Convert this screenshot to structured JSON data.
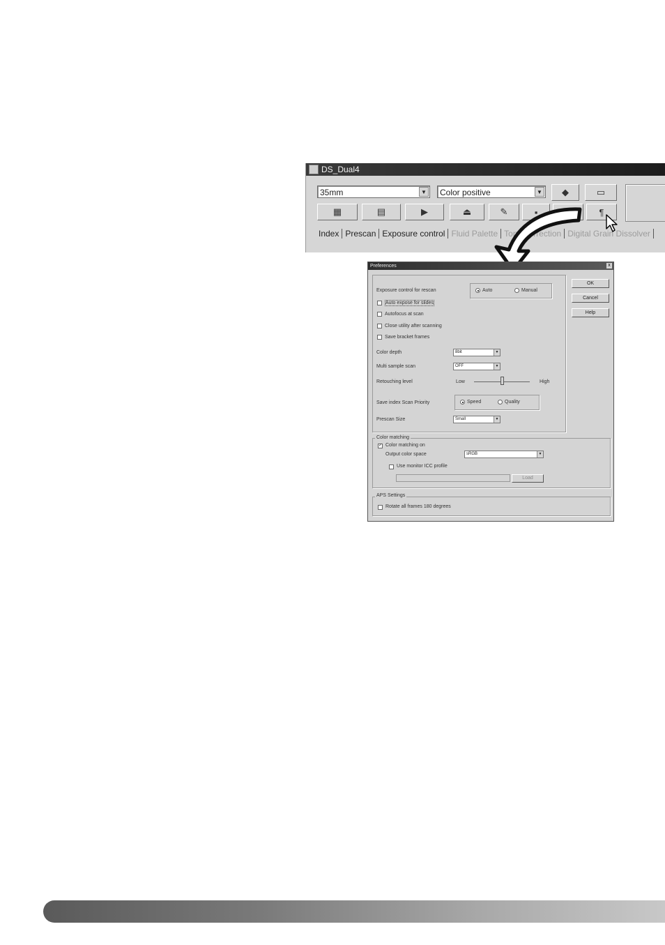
{
  "main_window": {
    "title": "DS_Dual4",
    "film_format": "35mm",
    "film_type": "Color positive",
    "tabs": [
      {
        "label": "Index",
        "enabled": true
      },
      {
        "label": "Prescan",
        "enabled": true
      },
      {
        "label": "Exposure control",
        "enabled": true
      },
      {
        "label": "Fluid Palette",
        "enabled": false
      },
      {
        "label": "Tone correction",
        "enabled": false
      },
      {
        "label": "Digital Grain Dissolver",
        "enabled": false
      }
    ]
  },
  "preferences_dialog": {
    "title": "Preferences",
    "close": "x",
    "exposure_control_label": "Exposure control for rescan",
    "exposure_auto": "Auto",
    "exposure_manual": "Manual",
    "checkboxes": [
      "Auto expose for slides",
      "Autofocus at scan",
      "Close utility after scanning",
      "Save bracket frames"
    ],
    "color_depth_label": "Color depth",
    "color_depth_value": "8bit",
    "multi_sample_label": "Multi sample scan",
    "multi_sample_value": "OFF",
    "retouching_label": "Retouching level",
    "retouching_low": "Low",
    "retouching_high": "High",
    "retouching_level": 0.5,
    "save_index_label": "Save index Scan Priority",
    "save_index_speed": "Speed",
    "save_index_quality": "Quality",
    "prescan_label": "Prescan Size",
    "prescan_value": "Small",
    "buttons": {
      "ok": "OK",
      "cancel": "Cancel",
      "help": "Help"
    },
    "color_matching": {
      "group_label": "Color matching",
      "enable_label": "Color matching on",
      "output_space_label": "Output color space",
      "output_space_value": "sRGB",
      "monitor_profile_label": "Use monitor ICC profile",
      "load_button": "Load"
    },
    "aps": {
      "group_label": "APS Settings",
      "rotate_label": "Rotate all frames 180 degrees"
    }
  },
  "colors": {
    "window_bg": "#d6d6d6",
    "titlebar": "#2a2a2a",
    "footer_start": "#5a5a5a",
    "footer_end": "#c8c8c8"
  }
}
